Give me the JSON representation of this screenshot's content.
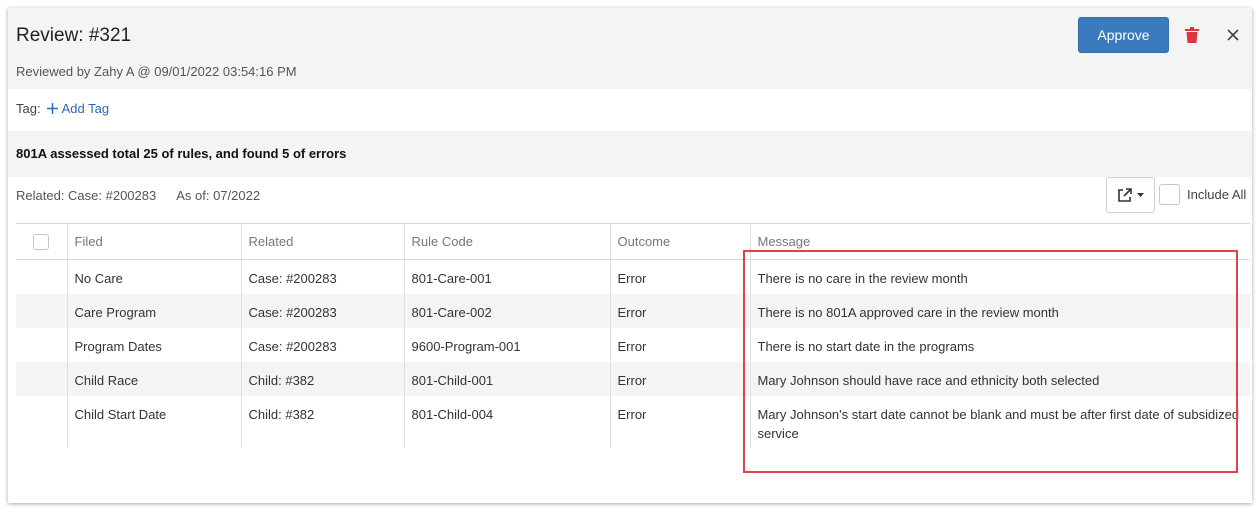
{
  "header": {
    "title": "Review: #321",
    "reviewed_by": "Reviewed by Zahy A @ 09/01/2022 03:54:16 PM",
    "approve_label": "Approve"
  },
  "tag": {
    "label": "Tag:",
    "add_label": "Add Tag"
  },
  "summary": "801A assessed total 25 of rules, and found 5 of errors",
  "related": {
    "case": "Related: Case: #200283",
    "as_of": "As of: 07/2022"
  },
  "toolbar": {
    "include_all_label": "Include All"
  },
  "table": {
    "columns": [
      "Filed",
      "Related",
      "Rule Code",
      "Outcome",
      "Message"
    ],
    "rows": [
      {
        "filed": "No Care",
        "related": "Case: #200283",
        "rule_code": "801-Care-001",
        "outcome": "Error",
        "message": "There is no care in the review month"
      },
      {
        "filed": "Care Program",
        "related": "Case: #200283",
        "rule_code": "801-Care-002",
        "outcome": "Error",
        "message": "There is no 801A approved care in the review month"
      },
      {
        "filed": "Program Dates",
        "related": "Case: #200283",
        "rule_code": "9600-Program-001",
        "outcome": "Error",
        "message": "There is no start date in the programs"
      },
      {
        "filed": "Child Race",
        "related": "Child: #382",
        "rule_code": "801-Child-001",
        "outcome": "Error",
        "message": "Mary Johnson should have race and ethnicity both selected"
      },
      {
        "filed": "Child Start Date",
        "related": "Child: #382",
        "rule_code": "801-Child-004",
        "outcome": "Error",
        "message": "Mary Johnson's start date cannot be blank and must be after first date of subsidized service"
      }
    ]
  },
  "colors": {
    "accent": "#3b7bbd",
    "danger": "#d9363e",
    "highlight": "#e0414c"
  }
}
